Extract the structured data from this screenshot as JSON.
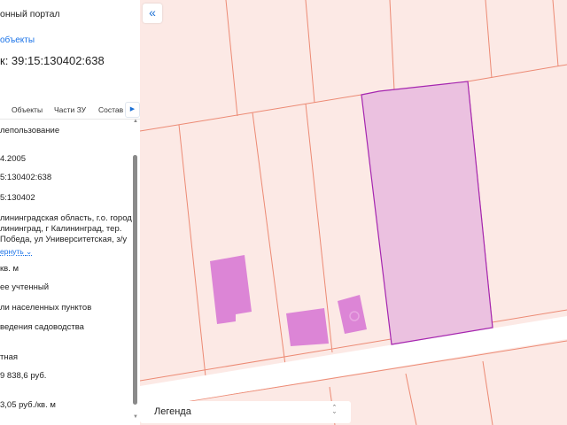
{
  "header": {
    "title": "онный портал",
    "link": "объекты",
    "cadastral_title": "к: 39:15:130402:638"
  },
  "tabs": [
    {
      "label": "Объекты"
    },
    {
      "label": "Части ЗУ"
    },
    {
      "label": "Состав"
    }
  ],
  "tab_next_icon": "chevron-right-icon",
  "details": {
    "land_use": "лепользование",
    "date": "4.2005",
    "cad_number": "5:130402:638",
    "cad_quarter": "5:130402",
    "address_line1": "лининградская область, г.о. город",
    "address_line2": "лининград, г Калининград, тер.",
    "address_line3": "Победа, ул Университетская, з/у",
    "collapse_link": "ернуть",
    "area": "кв. м",
    "status": "ее учтенный",
    "category": "ли населенных пунктов",
    "permitted_use": "ведения садоводства",
    "ownership": "тная",
    "cadastral_value": "9 838,6 руб.",
    "specific_value": "3,05 руб./кв. м"
  },
  "map": {
    "collapse_icon": "double-chevron-left-icon",
    "legend_label": "Легенда",
    "legend_icon": "chevron-up-down-icon",
    "colors": {
      "background": "#fce9e5",
      "parcel_line": "#ec8a74",
      "selected_fill": "#ebc1e0",
      "selected_stroke": "#a526b0",
      "building": "#dc85d6"
    }
  }
}
